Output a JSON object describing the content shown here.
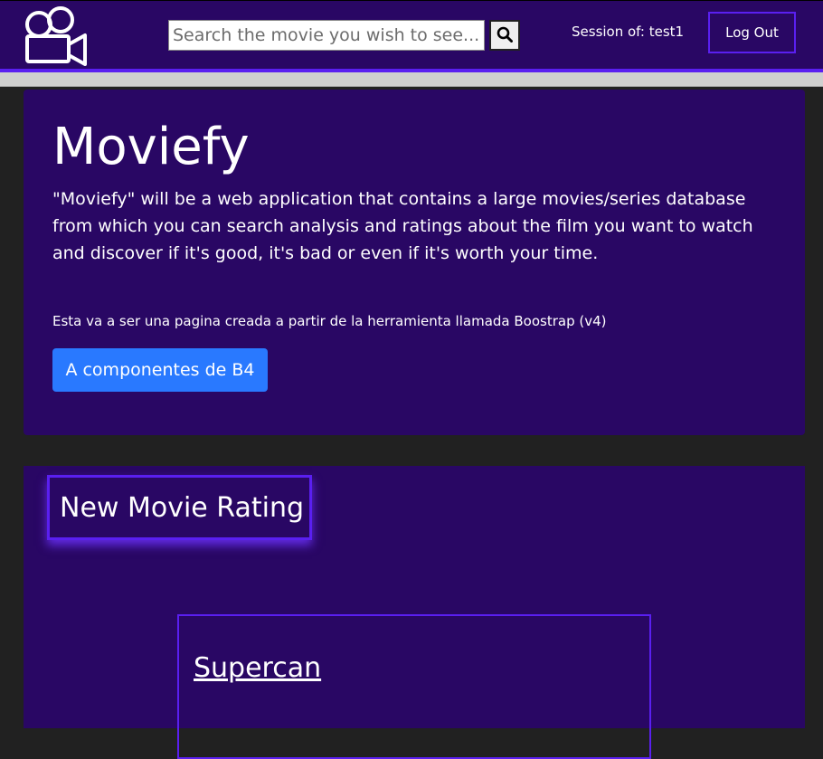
{
  "navbar": {
    "logo_icon": "movie-camera-icon",
    "search": {
      "placeholder": "Search the movie you wish to see...",
      "value": "",
      "button_icon": "search-icon"
    },
    "session_text": "Session of: test1",
    "logout_label": "Log Out"
  },
  "jumbotron": {
    "title": "Moviefy",
    "lead": "\"Moviefy\" will be a web application that contains a large movies/series database from which you can search analysis and ratings about the film you want to watch and discover if it's good, it's bad or even if it's worth your time.",
    "note": "Esta va a ser una pagina creada a partir de la herramienta llamada Boostrap (v4)",
    "button_label": "A componentes de B4"
  },
  "rating_section": {
    "title": "New Movie Rating",
    "movie": {
      "title": "Supercan"
    }
  },
  "colors": {
    "primary_purple": "#290764",
    "accent_violet": "#5a1ff0",
    "button_blue": "#2979ff",
    "page_background": "#212121"
  }
}
